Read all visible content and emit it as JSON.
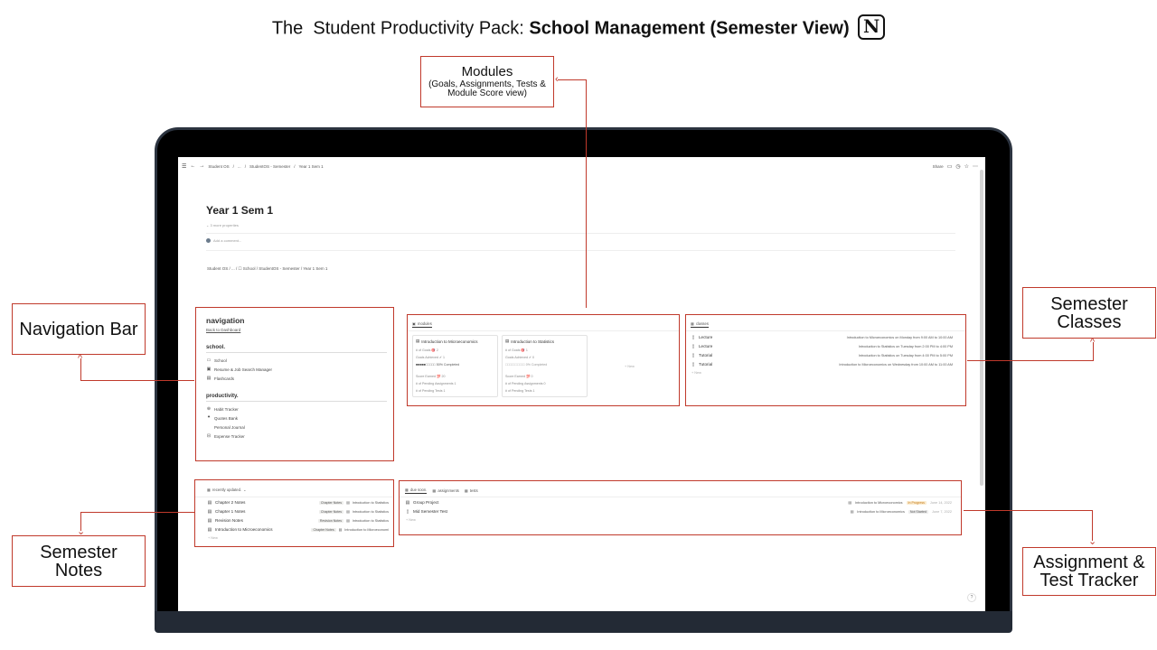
{
  "headline": {
    "prefix": "The  Student Productivity Pack: ",
    "bold": "School Management (Semester View)",
    "logo": "N"
  },
  "callouts": {
    "modules_title": "Modules",
    "modules_sub": "(Goals, Assignments, Tests & Module Score view)",
    "navigation": "Navigation Bar",
    "classes_line1": "Semester",
    "classes_line2": "Classes",
    "notes_line1": "Semester",
    "notes_line2": "Notes",
    "tracker_line1": "Assignment &",
    "tracker_line2": "Test Tracker"
  },
  "topbar": {
    "breadcrumb": [
      "Student OS",
      "...",
      "StudentOS - Semester",
      "Year 1 Sem 1"
    ],
    "share": "Share"
  },
  "page": {
    "title": "Year 1 Sem 1",
    "more_properties": "3 more properties",
    "add_comment": "Add a comment...",
    "breadcrumb": "Student OS  /  ...  /  ☐ School  /  StudentOS - Semester  /  Year 1 Sem 1"
  },
  "navigation": {
    "heading": "navigation",
    "back": "Back to Dashboard",
    "school_heading": "school.",
    "school_items": [
      "School",
      "Resume & Job Search Manager",
      "Flashcards"
    ],
    "productivity_heading": "productivity.",
    "productivity_items": [
      "Habit Tracker",
      "Quotes Bank",
      "Personal Journal",
      "Expense Tracker"
    ]
  },
  "modules": {
    "tab": "modules",
    "new": "+  New",
    "cards": [
      {
        "title": "Introduction to Microeconomics",
        "goals": "# of Goals 🎯  2",
        "achieved": "Goals Achieved ✔  1",
        "progress": "■■■■■□□□□□ 50% Completed",
        "score": "Score Earned 💯  20",
        "pending_assign": "# of Pending Assignments  1",
        "pending_tests": "# of Pending Tests  1"
      },
      {
        "title": "Introduction to Statistics",
        "goals": "# of Goals 🎯  1",
        "achieved": "Goals Achieved ✔  0",
        "progress": "□□□□□□□□□□ 0% Completed",
        "score": "Score Earned 💯  0",
        "pending_assign": "# of Pending Assignments  0",
        "pending_tests": "# of Pending Tests  1"
      }
    ]
  },
  "classes": {
    "tab": "classes",
    "new": "+  New",
    "rows": [
      {
        "name": "Lecture",
        "detail": "Introduction to Microeconomics on Monday from 9:00 AM to 10:00 AM"
      },
      {
        "name": "Lecture",
        "detail": "Introduction to Statistics on Tuesday from 2:00 PM to 4:00 PM"
      },
      {
        "name": "Tutorial",
        "detail": "Introduction to Statistics on Tuesday from 4:00 PM to 5:00 PM"
      },
      {
        "name": "Tutorial",
        "detail": "Introduction to Microeconomics on Wednesday from 10:00 AM to 11:00 AM"
      }
    ]
  },
  "notes": {
    "tab": "recently updated.",
    "new": "+  New",
    "rows": [
      {
        "name": "Chapter 2 Notes",
        "tag": "Chapter Notes",
        "module": "Introduction to Statistics"
      },
      {
        "name": "Chapter 1 Notes",
        "tag": "Chapter Notes",
        "module": "Introduction to Statistics"
      },
      {
        "name": "Revision Notes",
        "tag": "Revision Notes",
        "module": "Introduction to Statistics"
      },
      {
        "name": "Introduction to Microeconomics",
        "tag": "Chapter Notes",
        "module": "Introduction to Microeconomi"
      }
    ]
  },
  "tracker": {
    "tabs": [
      "due soon.",
      "assignments",
      "tests"
    ],
    "new": "+  New",
    "rows": [
      {
        "name": "Group Project",
        "module": "Introduction to Microeconomics",
        "status": "In Progress",
        "date": "June 14, 2022"
      },
      {
        "name": "Mid Semester Test",
        "module": "Introduction to Microeconomics",
        "status": "Not Started",
        "date": "June 7, 2022"
      }
    ]
  },
  "help": "?",
  "colors": {
    "callout_border": "#c0392b",
    "laptop": "#000000",
    "status_in_progress": "#fbecd0",
    "status_not_started": "#ececec"
  }
}
